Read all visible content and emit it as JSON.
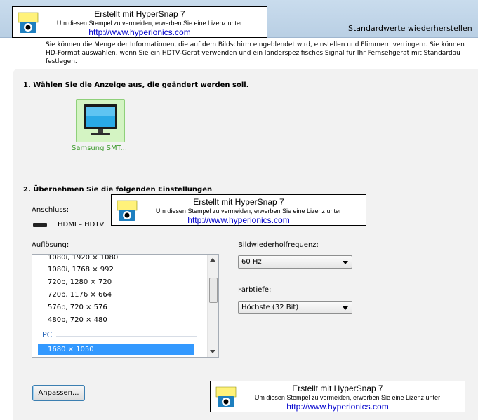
{
  "header": {
    "restore_link": "Standardwerte wiederherstellen"
  },
  "intro": "Sie können die Menge der Informationen, die auf dem Bildschirm eingeblendet wird, einstellen und Flimmern verringern. Sie können\nHD-Format auswählen, wenn Sie ein HDTV-Gerät verwenden und ein länderspezifisches Signal für Ihr Fernsehgerät mit Standardau\nfestlegen.",
  "section1": {
    "title": "1. Wählen Sie die Anzeige aus, die geändert werden soll.",
    "display_label": "Samsung SMT..."
  },
  "section2": {
    "title": "2. Übernehmen Sie die folgenden Einstellungen",
    "connection_label": "Anschluss:",
    "connection_value": "HDMI – HDTV",
    "resolution_label": "Auflösung:",
    "resolution_items": [
      "1080i, 1920 × 1080",
      "1080i, 1768 × 992",
      "720p, 1280 × 720",
      "720p, 1176 × 664",
      "576p, 720 × 576",
      "480p, 720 × 480"
    ],
    "resolution_group": "PC",
    "resolution_selected": "1680 × 1050",
    "refresh_label": "Bildwiederholfrequenz:",
    "refresh_value": "60 Hz",
    "color_depth_label": "Farbtiefe:",
    "color_depth_value": "Höchste (32 Bit)",
    "customize_button": "Anpassen..."
  },
  "stamp": {
    "line1": "Erstellt mit HyperSnap 7",
    "line2": "Um diesen Stempel zu vermeiden, erwerben Sie eine Lizenz unter",
    "line3": "http://www.hyperionics.com"
  },
  "colors": {
    "accent_selection": "#3399ff",
    "display_tile": "#d4f4c3",
    "link": "#0000cc"
  }
}
